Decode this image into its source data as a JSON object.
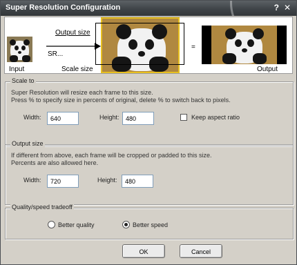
{
  "window": {
    "title": "Super Resolution Configuration",
    "help_icon": "?",
    "close_icon": "✕"
  },
  "preview": {
    "output_size_label": "Output size",
    "sr_label": "SR...",
    "equals": "=",
    "input_label": "Input",
    "scale_size_label": "Scale size",
    "output_label": "Output"
  },
  "scale_to": {
    "title": "Scale to",
    "desc_line1": "Super Resolution will resize each frame to this size.",
    "desc_line2": "Press % to specify size in percents of original, delete % to switch back to pixels.",
    "width_label": "Width:",
    "width_value": "640",
    "height_label": "Height:",
    "height_value": "480",
    "keep_aspect_label": "Keep aspect ratio",
    "keep_aspect_checked": false
  },
  "output_size": {
    "title": "Output size",
    "desc_line1": "If different from above, each frame will be cropped or padded to this size.",
    "desc_line2": "Percents are also allowed here.",
    "width_label": "Width:",
    "width_value": "720",
    "height_label": "Height:",
    "height_value": "480"
  },
  "quality": {
    "title": "Quality/speed tradeoff",
    "better_quality_label": "Better quality",
    "better_speed_label": "Better speed",
    "selected": "better_speed"
  },
  "buttons": {
    "ok_label": "OK",
    "cancel_label": "Cancel"
  }
}
